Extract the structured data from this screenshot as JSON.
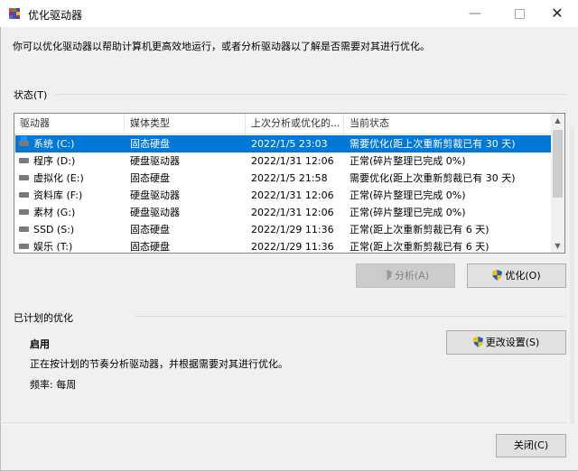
{
  "window": {
    "title": "优化驱动器",
    "controls": {
      "minimize": "—",
      "close": "✕"
    }
  },
  "description": "你可以优化驱动器以帮助计算机更高效地运行，或者分析驱动器以了解是否需要对其进行优化。",
  "status_group": {
    "label": "状态(T)"
  },
  "drives_table": {
    "columns": [
      "驱动器",
      "媒体类型",
      "上次分析或优化的...",
      "当前状态"
    ],
    "rows": [
      {
        "drive": "系统 (C:)",
        "media": "固态硬盘",
        "last": "2022/1/5 23:03",
        "status": "需要优化(距上次重新剪裁已有 30 天)",
        "selected": true,
        "icon": "system-drive-icon"
      },
      {
        "drive": "程序 (D:)",
        "media": "硬盘驱动器",
        "last": "2022/1/31 12:06",
        "status": "正常(碎片整理已完成 0%)",
        "icon": "drive-icon"
      },
      {
        "drive": "虚拟化 (E:)",
        "media": "固态硬盘",
        "last": "2022/1/5 21:58",
        "status": "需要优化(距上次重新剪裁已有 30 天)",
        "icon": "drive-icon"
      },
      {
        "drive": "资料库 (F:)",
        "media": "硬盘驱动器",
        "last": "2022/1/31 12:06",
        "status": "正常(碎片整理已完成 0%)",
        "icon": "drive-icon"
      },
      {
        "drive": "素材 (G:)",
        "media": "硬盘驱动器",
        "last": "2022/1/31 12:06",
        "status": "正常(碎片整理已完成 0%)",
        "icon": "drive-icon"
      },
      {
        "drive": "SSD (S:)",
        "media": "固态硬盘",
        "last": "2022/1/29 11:36",
        "status": "正常(距上次重新剪裁已有 6 天)",
        "icon": "drive-icon"
      },
      {
        "drive": "娱乐 (T:)",
        "media": "固态硬盘",
        "last": "2022/1/29 11:36",
        "status": "正常(距上次重新剪裁已有 6 天)",
        "icon": "drive-icon"
      }
    ]
  },
  "buttons": {
    "analyze": "分析(A)",
    "optimize": "优化(O)",
    "change_settings": "更改设置(S)",
    "close": "关闭(C)"
  },
  "scheduled": {
    "label": "已计划的优化",
    "state": "启用",
    "detail": "正在按计划的节奏分析驱动器，并根据需要对其进行优化。",
    "frequency": "频率: 每周"
  },
  "colors": {
    "selection": "#0078d7",
    "background": "#f0f0f0",
    "shield_blue": "#1f5fbf",
    "shield_yellow": "#f2c200"
  }
}
